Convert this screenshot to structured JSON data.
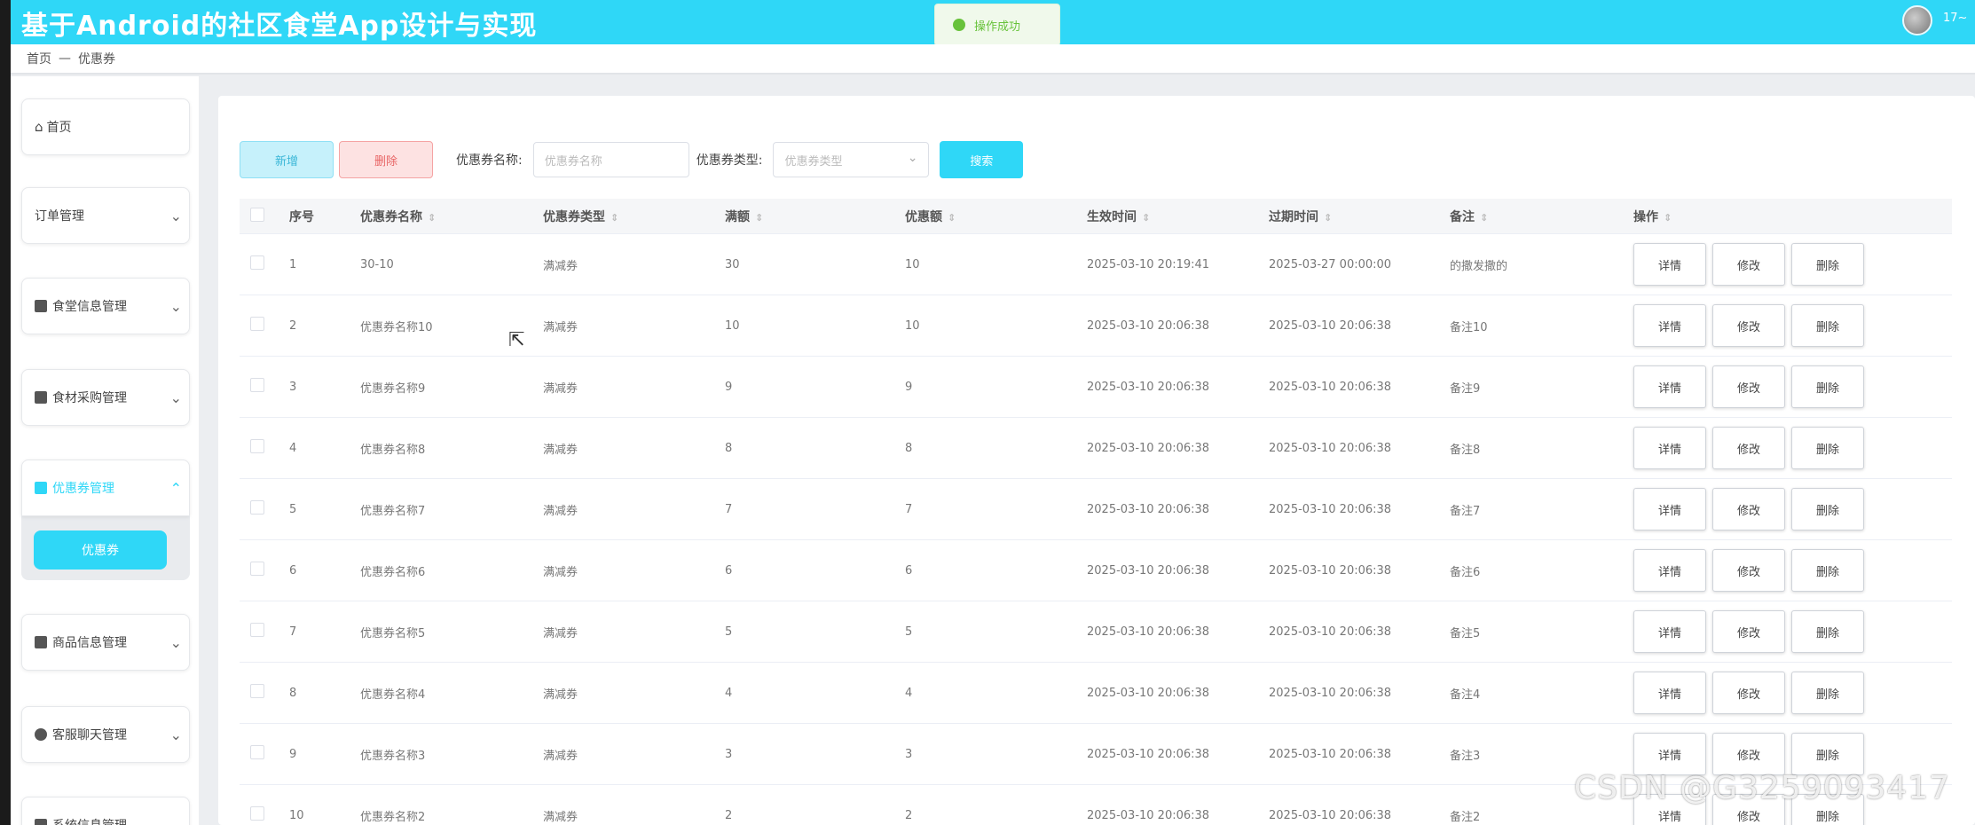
{
  "app": {
    "title": "基于Android的社区食堂App设计与实现",
    "user": "17~"
  },
  "toast": {
    "text": "操作成功",
    "color": "#67c23a"
  },
  "breadcrumb": {
    "home": "首页",
    "current": "优惠券"
  },
  "sidebar": {
    "home": "首页",
    "items": [
      {
        "label": "订单管理"
      },
      {
        "label": "食堂信息管理"
      },
      {
        "label": "食材采购管理"
      },
      {
        "label": "优惠券管理",
        "active": true,
        "sub": "优惠券"
      },
      {
        "label": "商品信息管理"
      },
      {
        "label": "客服聊天管理"
      },
      {
        "label": "系统信息管理"
      }
    ]
  },
  "toolbar": {
    "add": "新增",
    "delete": "删除",
    "name_label": "优惠券名称:",
    "name_placeholder": "优惠券名称",
    "type_label": "优惠券类型:",
    "type_placeholder": "优惠券类型",
    "search": "搜索"
  },
  "table": {
    "headers": [
      "序号",
      "优惠券名称",
      "优惠券类型",
      "满额",
      "优惠额",
      "生效时间",
      "过期时间",
      "备注",
      "操作"
    ],
    "actions": {
      "detail": "详情",
      "edit": "修改",
      "delete": "删除"
    },
    "rows": [
      [
        "1",
        "30-10",
        "满减券",
        "30",
        "10",
        "2025-03-10 20:19:41",
        "2025-03-27 00:00:00",
        "的撒发撒的",
        ""
      ],
      [
        "2",
        "优惠券名称10",
        "满减券",
        "10",
        "10",
        "2025-03-10 20:06:38",
        "2025-03-10 20:06:38",
        "备注10",
        ""
      ],
      [
        "3",
        "优惠券名称9",
        "满减券",
        "9",
        "9",
        "2025-03-10 20:06:38",
        "2025-03-10 20:06:38",
        "备注9",
        ""
      ],
      [
        "4",
        "优惠券名称8",
        "满减券",
        "8",
        "8",
        "2025-03-10 20:06:38",
        "2025-03-10 20:06:38",
        "备注8",
        ""
      ],
      [
        "5",
        "优惠券名称7",
        "满减券",
        "7",
        "7",
        "2025-03-10 20:06:38",
        "2025-03-10 20:06:38",
        "备注7",
        ""
      ],
      [
        "6",
        "优惠券名称6",
        "满减券",
        "6",
        "6",
        "2025-03-10 20:06:38",
        "2025-03-10 20:06:38",
        "备注6",
        ""
      ],
      [
        "7",
        "优惠券名称5",
        "满减券",
        "5",
        "5",
        "2025-03-10 20:06:38",
        "2025-03-10 20:06:38",
        "备注5",
        ""
      ],
      [
        "8",
        "优惠券名称4",
        "满减券",
        "4",
        "4",
        "2025-03-10 20:06:38",
        "2025-03-10 20:06:38",
        "备注4",
        ""
      ],
      [
        "9",
        "优惠券名称3",
        "满减券",
        "3",
        "3",
        "2025-03-10 20:06:38",
        "2025-03-10 20:06:38",
        "备注3",
        ""
      ],
      [
        "10",
        "优惠券名称2",
        "满减券",
        "2",
        "2",
        "2025-03-10 20:06:38",
        "2025-03-10 20:06:38",
        "备注2",
        ""
      ]
    ]
  },
  "watermark": "CSDN @G3259093417",
  "colors": {
    "accent": "#2fd7f7",
    "danger": "#e86565",
    "success": "#67c23a"
  }
}
